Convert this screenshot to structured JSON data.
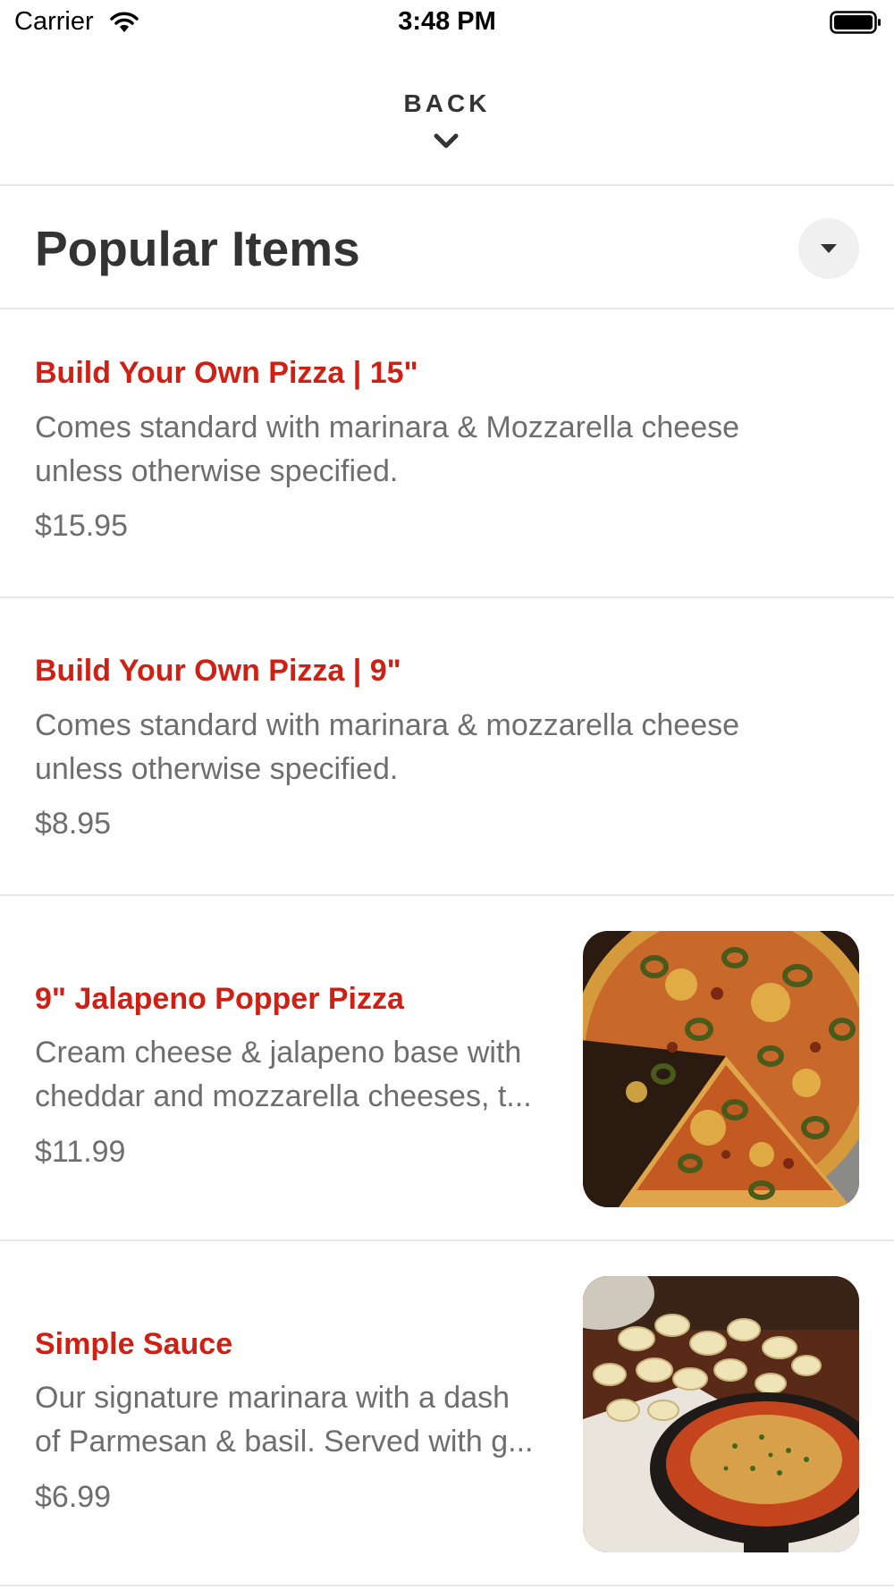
{
  "status_bar": {
    "carrier": "Carrier",
    "time": "3:48 PM"
  },
  "header": {
    "back_label": "BACK"
  },
  "section": {
    "title": "Popular Items"
  },
  "colors": {
    "accent": "#d01f13",
    "text_primary": "#333333",
    "text_secondary": "#6e6e6e",
    "divider": "#e8e8e8"
  },
  "items": [
    {
      "name": "Build Your Own Pizza | 15\"",
      "description_line1": "Comes standard with marinara & Mozzarella cheese",
      "description_line2": "unless otherwise specified.",
      "price": "$15.95"
    },
    {
      "name": "Build Your Own Pizza | 9\"",
      "description_line1": "Comes standard with marinara & mozzarella cheese",
      "description_line2": "unless otherwise specified.",
      "price": "$8.95"
    },
    {
      "name": "9\" Jalapeno Popper Pizza",
      "description_line1": "Cream cheese & jalapeno base with",
      "description_line2": "cheddar  and mozzarella cheeses, t...",
      "price": "$11.99",
      "image": "jalapeno-pizza-photo"
    },
    {
      "name": "Simple Sauce",
      "description_line1": "Our signature marinara with a dash",
      "description_line2": "of Parmesan & basil. Served with g...",
      "price": "$6.99",
      "image": "sauce-skillet-photo"
    }
  ]
}
